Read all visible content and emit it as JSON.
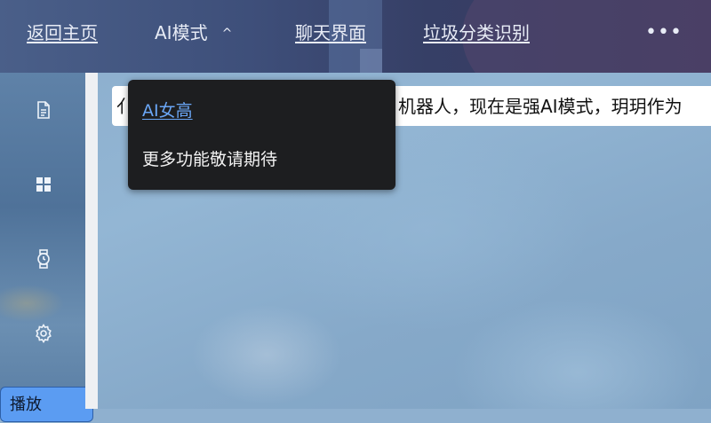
{
  "nav": {
    "home_label": "返回主页",
    "ai_mode_label": "AI模式",
    "ai_mode_chevron": "^",
    "chat_label": "聊天界面",
    "trash_label": "垃圾分类识别",
    "more_label": "•••"
  },
  "dropdown": {
    "items": [
      {
        "label": "AI女高"
      },
      {
        "label": "更多功能敬请期待"
      }
    ]
  },
  "message": {
    "lead_char": "亻",
    "visible_text": "机器人，现在是强AI模式，玥玥作为"
  },
  "sidebar": {
    "icons": [
      "document-icon",
      "grid-icon",
      "watch-icon",
      "gear-icon"
    ],
    "play_button_label": "播放"
  },
  "colors": {
    "topbar": "#3e4f7a",
    "dropdown_bg": "#1d1e20",
    "dropdown_link": "#6aa6f5",
    "play_button": "#5b9cf2"
  }
}
